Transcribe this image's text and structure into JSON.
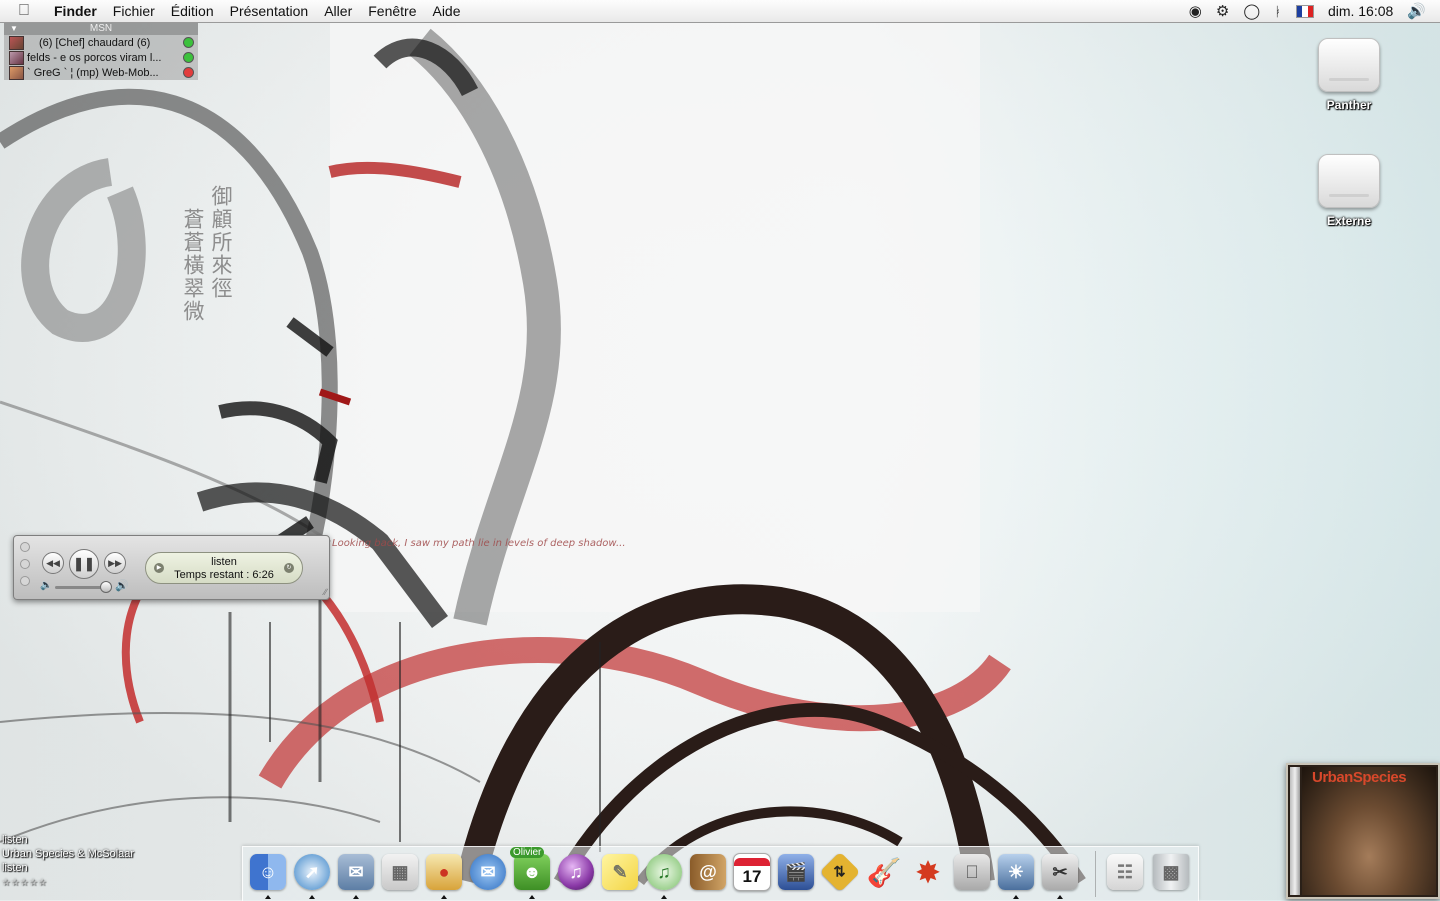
{
  "menubar": {
    "app_name": "Finder",
    "menus": [
      "Fichier",
      "Édition",
      "Présentation",
      "Aller",
      "Fenêtre",
      "Aide"
    ],
    "clock": "dim. 16:08",
    "status_icons": [
      "alien-icon",
      "gears-icon",
      "speech-bubble-icon",
      "bluetooth-icon",
      "french-flag-icon",
      "volume-icon"
    ]
  },
  "msn": {
    "title": "MSN",
    "contacts": [
      {
        "name": "(6) [Chef] chaudard (6)",
        "status": "online",
        "status_color": "#3cc13c"
      },
      {
        "name": "felds - e os porcos viram l...",
        "status": "online",
        "status_color": "#3cc13c"
      },
      {
        "name": "` GreG ` ¦ (mp) Web-Mob...",
        "status": "busy",
        "status_color": "#e23c3c"
      }
    ]
  },
  "desktop": {
    "icons": [
      {
        "label": "Panther",
        "type": "hard-disk-icon"
      },
      {
        "label": "Externe",
        "type": "firewire-disk-icon"
      }
    ]
  },
  "wallpaper": {
    "kanji_col1": "御顧所來徑",
    "kanji_col2": "蒼蒼橫翠微",
    "quote": "Looking back, I saw my path lie in levels of deep shadow..."
  },
  "player": {
    "track": "listen",
    "time_remaining": "Temps restant : 6:26",
    "volume_level": 0.85
  },
  "now_playing": {
    "track": "listen",
    "artist": "Urban Species & McSolaar",
    "album": "listen",
    "rating_stars": "☆☆☆☆☆"
  },
  "album_art": {
    "title": "UrbanSpecies"
  },
  "dock": {
    "items": [
      {
        "name": "Finder",
        "icon": "finder-icon",
        "color": "#4a7fd6",
        "running": true
      },
      {
        "name": "Safari",
        "icon": "safari-icon",
        "color": "#3d86c9",
        "running": true
      },
      {
        "name": "Mail",
        "icon": "mail-icon",
        "color": "#6f8fb5",
        "running": true
      },
      {
        "name": "Preview",
        "icon": "preview-icon",
        "color": "#d9d9d9",
        "running": false
      },
      {
        "name": "Popcorn",
        "icon": "popcorn-icon",
        "color": "#d8a33a",
        "running": true
      },
      {
        "name": "iChat",
        "icon": "ichat-icon",
        "color": "#3a84d8",
        "running": false
      },
      {
        "name": "Olivier",
        "icon": "msn-icon",
        "color": "#54a833",
        "running": true,
        "badge": "Olivier"
      },
      {
        "name": "Audion",
        "icon": "purple-sphere-icon",
        "color": "#8b3aa8",
        "running": false
      },
      {
        "name": "Stickies",
        "icon": "stickies-icon",
        "color": "#f3d545",
        "running": false
      },
      {
        "name": "iTunes",
        "icon": "itunes-icon",
        "color": "#7bc06a",
        "running": true
      },
      {
        "name": "Address Book",
        "icon": "address-book-icon",
        "color": "#b88a4a",
        "running": false
      },
      {
        "name": "iCal",
        "icon": "ical-icon",
        "color": "#ffffff",
        "running": false,
        "cal_day": "17"
      },
      {
        "name": "iMovie",
        "icon": "imovie-icon",
        "color": "#4c6fb0",
        "running": false
      },
      {
        "name": "Transmit",
        "icon": "transmit-icon",
        "color": "#e4b330",
        "running": false
      },
      {
        "name": "GarageBand",
        "icon": "guitar-icon",
        "color": "#b06a2c",
        "running": false
      },
      {
        "name": "Firewall",
        "icon": "fire-icon",
        "color": "#d43a1f",
        "running": false
      },
      {
        "name": "System Preferences",
        "icon": "apple-icon",
        "color": "#bfbfbf",
        "running": false
      },
      {
        "name": "iPhoto",
        "icon": "iphoto-icon",
        "color": "#5b83b5",
        "running": true
      },
      {
        "name": "Script Editor",
        "icon": "scissors-icon",
        "color": "#aaaaaa",
        "running": true
      },
      {
        "name": "Documents",
        "icon": "documents-stack-icon",
        "color": "#e8e8e8",
        "running": false
      },
      {
        "name": "Trash",
        "icon": "trash-icon",
        "color": "#cfd3d6",
        "running": false
      }
    ]
  }
}
